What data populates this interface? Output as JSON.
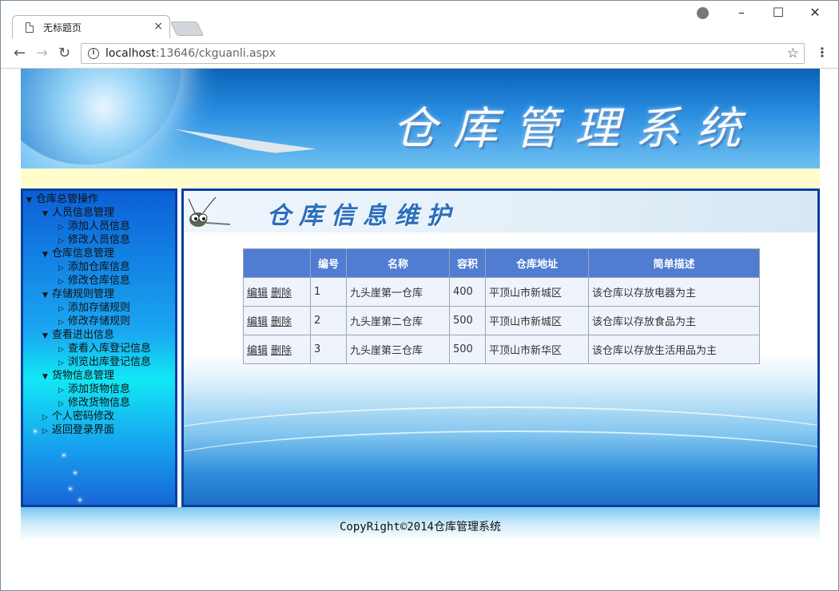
{
  "browser": {
    "tab_title": "无标题页",
    "tab_close": "×",
    "url_host": "localhost",
    "url_rest": ":13646/ckguanli.aspx"
  },
  "banner": {
    "title": "仓库管理系统"
  },
  "sidebar": {
    "items": [
      {
        "label": "仓库总管操作",
        "level": 0,
        "expanded": true
      },
      {
        "label": "人员信息管理",
        "level": 1,
        "expanded": true
      },
      {
        "label": "添加人员信息",
        "level": 2,
        "expanded": false
      },
      {
        "label": "修改人员信息",
        "level": 2,
        "expanded": false
      },
      {
        "label": "仓库信息管理",
        "level": 1,
        "expanded": true
      },
      {
        "label": "添加仓库信息",
        "level": 2,
        "expanded": false
      },
      {
        "label": "修改仓库信息",
        "level": 2,
        "expanded": false
      },
      {
        "label": "存储规则管理",
        "level": 1,
        "expanded": true
      },
      {
        "label": "添加存储规则",
        "level": 2,
        "expanded": false
      },
      {
        "label": "修改存储规则",
        "level": 2,
        "expanded": false
      },
      {
        "label": "查看进出信息",
        "level": 1,
        "expanded": true
      },
      {
        "label": "查看入库登记信息",
        "level": 2,
        "expanded": false
      },
      {
        "label": "浏览出库登记信息",
        "level": 2,
        "expanded": false
      },
      {
        "label": "货物信息管理",
        "level": 1,
        "expanded": true
      },
      {
        "label": "添加货物信息",
        "level": 2,
        "expanded": false
      },
      {
        "label": "修改货物信息",
        "level": 2,
        "expanded": false
      },
      {
        "label": "个人密码修改",
        "level": 1,
        "expanded": false
      },
      {
        "label": "返回登录界面",
        "level": 1,
        "expanded": false
      }
    ]
  },
  "main": {
    "heading": "仓库信息维护",
    "table": {
      "headers": [
        "",
        "编号",
        "名称",
        "容积",
        "仓库地址",
        "简单描述"
      ],
      "edit_label": "编辑",
      "delete_label": "删除",
      "rows": [
        [
          "1",
          "九头崖第一仓库",
          "400",
          "平顶山市新城区",
          "该仓库以存放电器为主"
        ],
        [
          "2",
          "九头崖第二仓库",
          "500",
          "平顶山市新城区",
          "该仓库以存放食品为主"
        ],
        [
          "3",
          "九头崖第三仓库",
          "500",
          "平顶山市新华区",
          "该仓库以存放生活用品为主"
        ]
      ]
    }
  },
  "footer": {
    "text": "CopyRight©2014仓库管理系统"
  },
  "colors": {
    "header_row": "#507cd1",
    "border": "#0b3f9b",
    "stripe": "#fffdcb"
  }
}
